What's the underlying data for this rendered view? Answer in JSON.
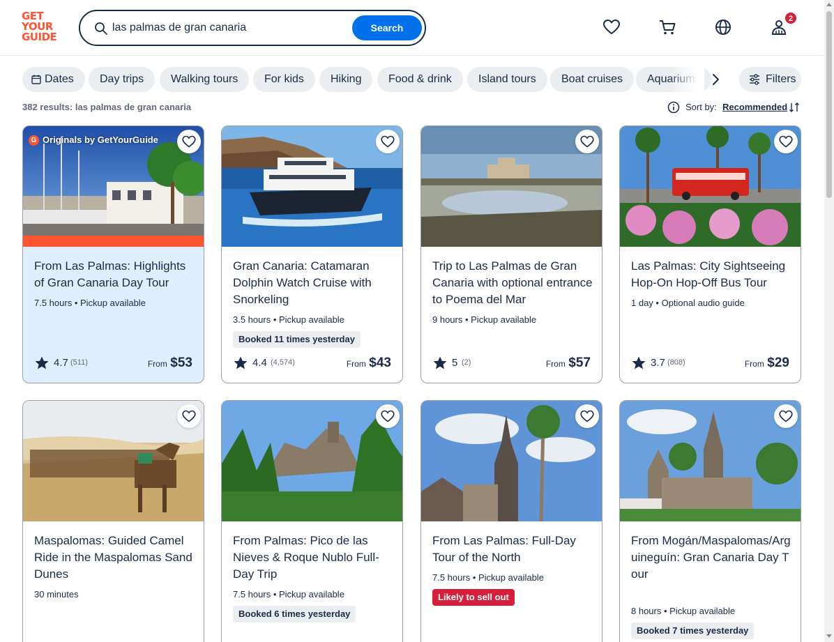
{
  "header": {
    "logo": [
      "GET",
      "YOUR",
      "GUIDE"
    ],
    "search_value": "las palmas de gran canaria",
    "search_button": "Search",
    "cart_badge": "2"
  },
  "chips": [
    "Dates",
    "Day trips",
    "Walking tours",
    "For kids",
    "Hiking",
    "Food & drink",
    "Island tours",
    "Boat cruises",
    "Aquariums"
  ],
  "filters_label": "Filters",
  "results": {
    "count_text": "382 results: las palmas de gran canaria",
    "sort_label": "Sort by:",
    "sort_value": "Recommended"
  },
  "cards": [
    {
      "badge": "Originals by GetYourGuide",
      "title": "From Las Palmas: Highlights of Gran Canaria Day Tour",
      "meta": "7.5 hours • Pickup available",
      "tag": "",
      "rating": "4.7",
      "reviews": "(511)",
      "from": "From",
      "price": "$53"
    },
    {
      "badge": "",
      "title": "Gran Canaria: Catamaran Dolphin Watch Cruise with Snorkeling",
      "meta": "3.5 hours • Pickup available",
      "tag": "Booked 11 times yesterday",
      "rating": "4.4",
      "reviews": "(4,574)",
      "from": "From",
      "price": "$43"
    },
    {
      "badge": "",
      "title": "Trip to Las Palmas de Gran Canaria with optional entrance to Poema del Mar",
      "meta": "9 hours • Pickup available",
      "tag": "",
      "rating": "5",
      "reviews": "(2)",
      "from": "From",
      "price": "$57"
    },
    {
      "badge": "",
      "title": "Las Palmas: City Sightseeing Hop-On Hop-Off Bus Tour",
      "meta": "1 day • Optional audio guide",
      "tag": "",
      "rating": "3.7",
      "reviews": "(808)",
      "from": "From",
      "price": "$29"
    },
    {
      "badge": "",
      "title": "Maspalomas: Guided Camel Ride in the Maspalomas Sand Dunes",
      "meta": "30 minutes",
      "tag": ""
    },
    {
      "badge": "",
      "title": "From Palmas: Pico de las Nieves & Roque Nublo Full-Day Trip",
      "meta": "7.5 hours • Pickup available",
      "tag": "Booked 6 times yesterday"
    },
    {
      "badge": "",
      "title": "From Las Palmas: Full-Day Tour of the North",
      "meta": "7.5 hours • Pickup available",
      "tag": "Likely to sell out"
    },
    {
      "badge": "",
      "title": "From Mogán/Maspalomas/Arguineguín: Gran Canaria Day Tour",
      "meta": "8 hours • Pickup available",
      "tag": "Booked 7 times yesterday"
    }
  ]
}
